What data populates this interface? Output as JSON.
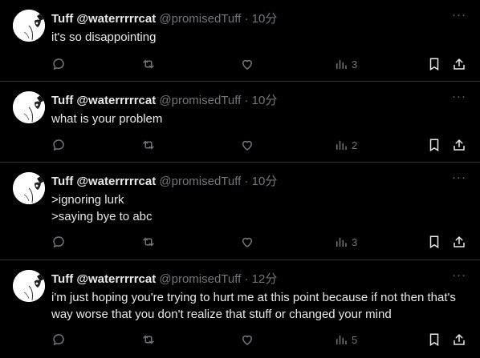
{
  "tweets": [
    {
      "name": "Tuff @waterrrrrcat",
      "handle": "@promisedTuff",
      "dot": "·",
      "time": "10分",
      "lines": [
        "it's so disappointing"
      ],
      "views": "3"
    },
    {
      "name": "Tuff @waterrrrrcat",
      "handle": "@promisedTuff",
      "dot": "·",
      "time": "10分",
      "lines": [
        "what is your problem"
      ],
      "views": "2"
    },
    {
      "name": "Tuff @waterrrrrcat",
      "handle": "@promisedTuff",
      "dot": "·",
      "time": "10分",
      "lines": [
        ">ignoring lurk",
        ">saying bye to abc"
      ],
      "views": "3"
    },
    {
      "name": "Tuff @waterrrrrcat",
      "handle": "@promisedTuff",
      "dot": "·",
      "time": "12分",
      "lines": [
        "i'm just hoping you're trying to hurt me at this point because if not then that's",
        "way worse that you don't realize that stuff or changed your mind"
      ],
      "views": "5"
    }
  ],
  "icons": {
    "more": "more-horizontal-icon",
    "reply": "reply-icon",
    "retweet": "retweet-icon",
    "like": "like-heart-icon",
    "views": "views-bar-chart-icon",
    "bookmark": "bookmark-icon",
    "share": "share-icon"
  },
  "colors": {
    "background": "#000000",
    "text": "#e7e9ea",
    "muted": "#71767b",
    "divider": "#2f3336"
  }
}
